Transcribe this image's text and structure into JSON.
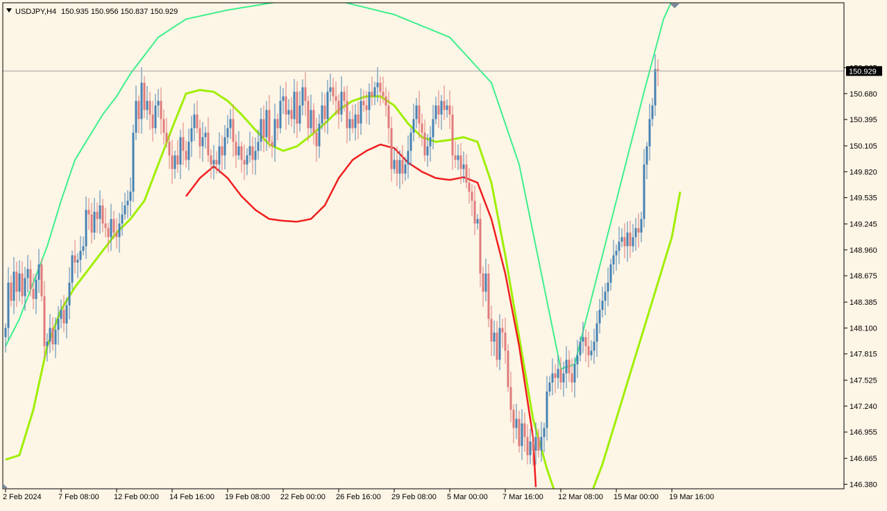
{
  "header": {
    "symbol": "USDJPY,H4",
    "ohlc": "150.935 150.956 150.837 150.929"
  },
  "colors": {
    "background": "#fdf5e6",
    "bull_candle": "#4682b4",
    "bear_candle": "#e07b7b",
    "upper_band": "#3cf08c",
    "mid_line": "#9fef00",
    "lower_line": "#f01e1e",
    "bid_line": "#a0a0a0"
  },
  "chart_data": {
    "type": "candlestick",
    "symbol": "USDJPY",
    "timeframe": "H4",
    "current_price": 150.929,
    "y_ticks": [
      150.965,
      150.68,
      150.395,
      150.105,
      149.82,
      149.535,
      149.245,
      148.96,
      148.675,
      148.385,
      148.1,
      147.815,
      147.525,
      147.24,
      146.955,
      146.665,
      146.38
    ],
    "y_tick_labels": [
      "150.965",
      "150.680",
      "150.395",
      "150.105",
      "149.820",
      "149.535",
      "149.245",
      "148.960",
      "148.675",
      "148.385",
      "148.100",
      "147.815",
      "147.525",
      "147.240",
      "146.955",
      "146.665",
      "146.380"
    ],
    "ylim": [
      146.33,
      151.68
    ],
    "x_labels": [
      "2 Feb 2024",
      "7 Feb 08:00",
      "12 Feb 00:00",
      "14 Feb 16:00",
      "19 Feb 08:00",
      "22 Feb 00:00",
      "26 Feb 16:00",
      "29 Feb 08:00",
      "5 Mar 00:00",
      "7 Mar 16:00",
      "12 Mar 08:00",
      "15 Mar 00:00",
      "19 Mar 16:00"
    ],
    "x_label_index": [
      0,
      20,
      40,
      60,
      80,
      100,
      120,
      140,
      160,
      180,
      200,
      220,
      240
    ],
    "closes": [
      148.1,
      148.6,
      148.4,
      148.72,
      148.5,
      148.7,
      148.45,
      148.65,
      148.75,
      148.53,
      148.42,
      148.63,
      148.8,
      148.45,
      147.9,
      147.95,
      148.1,
      147.92,
      148.08,
      148.2,
      148.3,
      148.15,
      148.35,
      148.6,
      148.9,
      148.82,
      148.85,
      148.95,
      149.0,
      149.4,
      149.35,
      149.15,
      149.38,
      149.3,
      149.45,
      149.25,
      149.2,
      149.1,
      149.3,
      149.15,
      149.1,
      149.25,
      149.35,
      149.45,
      149.5,
      149.6,
      150.25,
      150.6,
      150.4,
      150.8,
      150.5,
      150.6,
      150.45,
      150.3,
      150.55,
      150.6,
      150.4,
      150.25,
      150.15,
      150.0,
      149.85,
      150.0,
      149.9,
      150.2,
      150.05,
      149.95,
      150.15,
      150.3,
      150.45,
      150.3,
      150.1,
      150.2,
      150.25,
      150.0,
      149.9,
      149.95,
      149.9,
      150.1,
      150.0,
      150.2,
      150.3,
      150.4,
      150.15,
      150.0,
      150.1,
      149.95,
      149.9,
      150.0,
      150.1,
      149.95,
      150.05,
      150.15,
      150.4,
      150.2,
      150.5,
      150.15,
      150.1,
      150.4,
      150.3,
      150.6,
      150.65,
      150.45,
      150.5,
      150.4,
      150.7,
      150.35,
      150.55,
      150.75,
      150.6,
      150.3,
      150.5,
      150.25,
      150.1,
      150.35,
      150.55,
      150.4,
      150.7,
      150.75,
      150.65,
      150.6,
      150.45,
      150.7,
      150.6,
      150.3,
      150.4,
      150.3,
      150.45,
      150.35,
      150.6,
      150.55,
      150.5,
      150.7,
      150.65,
      150.75,
      150.8,
      150.7,
      150.65,
      150.55,
      150.3,
      149.85,
      149.95,
      149.8,
      149.95,
      149.8,
      149.9,
      150.05,
      150.25,
      150.4,
      150.55,
      150.35,
      150.25,
      150.0,
      150.1,
      150.2,
      150.4,
      150.55,
      150.45,
      150.6,
      150.5,
      150.55,
      150.45,
      150.0,
      149.95,
      150.0,
      149.85,
      149.9,
      149.7,
      149.6,
      149.5,
      149.25,
      149.3,
      148.7,
      148.5,
      148.7,
      148.2,
      147.95,
      148.05,
      147.75,
      148.1,
      148.05,
      147.85,
      147.45,
      147.2,
      147.0,
      147.1,
      146.8,
      147.05,
      146.9,
      146.7,
      146.85,
      146.75,
      146.9,
      146.75,
      146.9,
      147.0,
      147.4,
      147.5,
      147.6,
      147.55,
      147.65,
      147.5,
      147.6,
      147.75,
      147.6,
      147.5,
      147.7,
      147.8,
      147.95,
      148.0,
      147.9,
      147.8,
      147.85,
      147.95,
      148.15,
      148.3,
      148.4,
      148.5,
      148.6,
      148.8,
      148.9,
      148.95,
      149.05,
      149.1,
      149.0,
      149.15,
      149.0,
      149.1,
      149.2,
      149.15,
      149.3,
      149.9,
      150.1,
      150.4,
      150.55,
      150.95,
      150.929
    ],
    "band_upper": {
      "start": 0,
      "end": 243,
      "points": [
        [
          0,
          147.9
        ],
        [
          5,
          148.2
        ],
        [
          10,
          148.6
        ],
        [
          15,
          149.0
        ],
        [
          20,
          149.5
        ],
        [
          25,
          149.95
        ],
        [
          30,
          150.2
        ],
        [
          35,
          150.45
        ],
        [
          40,
          150.65
        ],
        [
          45,
          150.9
        ],
        [
          55,
          151.3
        ],
        [
          65,
          151.5
        ],
        [
          80,
          151.6
        ],
        [
          100,
          151.7
        ],
        [
          120,
          151.7
        ],
        [
          140,
          151.55
        ],
        [
          160,
          151.3
        ],
        [
          175,
          150.8
        ],
        [
          185,
          149.9
        ],
        [
          195,
          148.4
        ],
        [
          200,
          147.65
        ],
        [
          205,
          147.7
        ],
        [
          210,
          148.3
        ],
        [
          220,
          149.5
        ],
        [
          230,
          150.7
        ],
        [
          237,
          151.5
        ],
        [
          243,
          151.9
        ]
      ]
    },
    "band_mid": {
      "start": 0,
      "end": 243,
      "points": [
        [
          0,
          146.65
        ],
        [
          5,
          146.7
        ],
        [
          10,
          147.2
        ],
        [
          15,
          147.9
        ],
        [
          20,
          148.3
        ],
        [
          25,
          148.55
        ],
        [
          30,
          148.75
        ],
        [
          35,
          148.95
        ],
        [
          40,
          149.15
        ],
        [
          45,
          149.3
        ],
        [
          50,
          149.5
        ],
        [
          55,
          149.9
        ],
        [
          60,
          150.3
        ],
        [
          65,
          150.68
        ],
        [
          70,
          150.72
        ],
        [
          75,
          150.7
        ],
        [
          80,
          150.6
        ],
        [
          85,
          150.45
        ],
        [
          90,
          150.28
        ],
        [
          95,
          150.12
        ],
        [
          100,
          150.05
        ],
        [
          105,
          150.1
        ],
        [
          110,
          150.22
        ],
        [
          115,
          150.35
        ],
        [
          120,
          150.5
        ],
        [
          125,
          150.6
        ],
        [
          130,
          150.65
        ],
        [
          135,
          150.65
        ],
        [
          140,
          150.55
        ],
        [
          145,
          150.35
        ],
        [
          150,
          150.2
        ],
        [
          155,
          150.15
        ],
        [
          160,
          150.17
        ],
        [
          165,
          150.2
        ],
        [
          170,
          150.15
        ],
        [
          175,
          149.7
        ],
        [
          180,
          148.9
        ],
        [
          185,
          148.0
        ],
        [
          190,
          147.1
        ],
        [
          195,
          146.55
        ],
        [
          200,
          146.1
        ],
        [
          205,
          145.9
        ],
        [
          210,
          146.2
        ],
        [
          215,
          146.6
        ],
        [
          220,
          147.1
        ],
        [
          225,
          147.6
        ],
        [
          230,
          148.1
        ],
        [
          235,
          148.6
        ],
        [
          240,
          149.1
        ],
        [
          243,
          149.6
        ]
      ]
    },
    "band_lower": {
      "start": 65,
      "end": 191,
      "points": [
        [
          65,
          149.55
        ],
        [
          70,
          149.75
        ],
        [
          75,
          149.88
        ],
        [
          80,
          149.75
        ],
        [
          85,
          149.55
        ],
        [
          90,
          149.4
        ],
        [
          95,
          149.3
        ],
        [
          100,
          149.28
        ],
        [
          105,
          149.27
        ],
        [
          110,
          149.3
        ],
        [
          115,
          149.45
        ],
        [
          120,
          149.75
        ],
        [
          125,
          149.95
        ],
        [
          130,
          150.05
        ],
        [
          135,
          150.12
        ],
        [
          140,
          150.08
        ],
        [
          145,
          149.92
        ],
        [
          150,
          149.82
        ],
        [
          155,
          149.75
        ],
        [
          160,
          149.73
        ],
        [
          165,
          149.76
        ],
        [
          170,
          149.7
        ],
        [
          175,
          149.3
        ],
        [
          180,
          148.7
        ],
        [
          185,
          147.9
        ],
        [
          190,
          146.9
        ],
        [
          191,
          146.35
        ]
      ]
    }
  }
}
